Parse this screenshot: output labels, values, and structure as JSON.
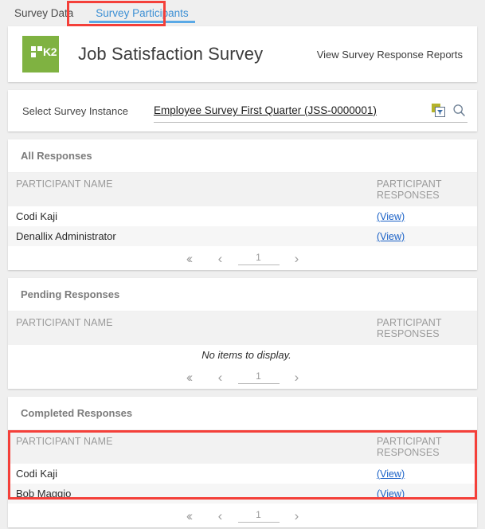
{
  "tabs": [
    {
      "label": "Survey Data",
      "active": false
    },
    {
      "label": "Survey Participants",
      "active": true
    }
  ],
  "header": {
    "logo_text": "K2",
    "logo_color": "#7fb241",
    "title": "Job Satisfaction Survey",
    "reports_link": "View Survey Response Reports"
  },
  "instance_selector": {
    "label": "Select Survey Instance",
    "value": "Employee Survey First Quarter (JSS-0000001)",
    "picker_icon": "list-picker-icon",
    "search_icon": "magnifier-icon"
  },
  "columns": {
    "name": "PARTICIPANT NAME",
    "responses": "PARTICIPANT RESPONSES"
  },
  "view_label": "(View)",
  "empty_message": "No items to display.",
  "pager": {
    "first_icon": "double-chevron-left-icon",
    "prev_icon": "chevron-left-icon",
    "page": "1",
    "next_icon": "chevron-right-icon"
  },
  "sections": [
    {
      "title": "All Responses",
      "rows": [
        {
          "name": "Codi Kaji",
          "response": "(View)"
        },
        {
          "name": "Denallix Administrator",
          "response": "(View)"
        }
      ],
      "empty": false,
      "highlighted": false
    },
    {
      "title": "Pending Responses",
      "rows": [],
      "empty": true,
      "highlighted": false
    },
    {
      "title": "Completed Responses",
      "rows": [
        {
          "name": "Codi Kaji",
          "response": "(View)"
        },
        {
          "name": "Bob Maggio",
          "response": "(View)"
        }
      ],
      "empty": false,
      "highlighted": true
    }
  ],
  "annotation_color": "#f4403a"
}
